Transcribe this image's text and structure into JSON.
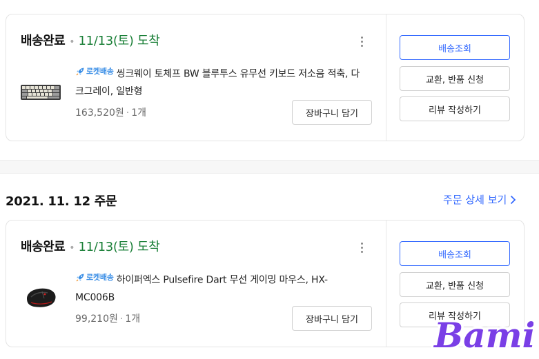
{
  "orders": [
    {
      "status": "배송완료",
      "eta": "11/13(토) 도착",
      "badge": "로켓배송",
      "product_title": "씽크웨이 토체프 BW 블루투스 유무선 키보드 저소음 적축, 다크그레이, 일반형",
      "price": "163,520원",
      "qty": "1개",
      "cart_button": "장바구니 담기",
      "actions": [
        "배송조회",
        "교환, 반품 신청",
        "리뷰 작성하기"
      ]
    },
    {
      "status": "배송완료",
      "eta": "11/13(토) 도착",
      "badge": "로켓배송",
      "product_title": "하이퍼엑스 Pulsefire Dart 무선 게이밍 마우스, HX-MC006B",
      "price": "99,210원",
      "qty": "1개",
      "cart_button": "장바구니 담기",
      "actions": [
        "배송조회",
        "교환, 반품 신청",
        "리뷰 작성하기"
      ]
    }
  ],
  "order_group": {
    "date": "2021. 11. 12 주문",
    "detail_link": "주문 상세 보기"
  },
  "watermark": "Bami",
  "colors": {
    "eta_green": "#1a7f37",
    "accent_blue": "#346aff",
    "rocket_blue": "#3a8ee6",
    "watermark_purple": "#7a3fe6"
  },
  "icons": [
    "rocket-icon",
    "kebab-menu-icon",
    "chevron-right-icon",
    "keyboard-thumbnail",
    "mouse-thumbnail"
  ]
}
